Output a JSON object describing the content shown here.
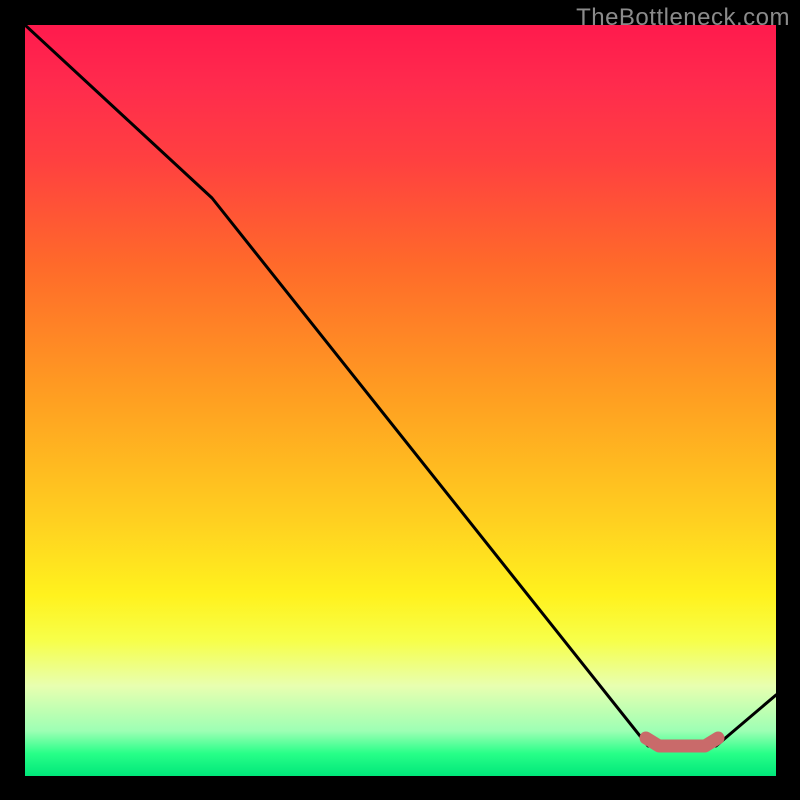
{
  "watermark": "TheBottleneck.com",
  "chart_data": {
    "type": "line",
    "title": "",
    "xlabel": "",
    "ylabel": "",
    "xlim": [
      0,
      1
    ],
    "ylim": [
      0,
      1
    ],
    "series": [
      {
        "name": "bottleneck-curve",
        "x": [
          0.0,
          0.25,
          0.83,
          0.92,
          1.0
        ],
        "y": [
          1.0,
          0.77,
          0.04,
          0.04,
          0.11
        ],
        "color": "#000000"
      },
      {
        "name": "optimal-range",
        "x": [
          0.83,
          0.845,
          0.905,
          0.92
        ],
        "y": [
          0.05,
          0.04,
          0.04,
          0.05
        ],
        "color": "#c96a6a"
      }
    ],
    "gradient_stops": [
      {
        "pos": 0.0,
        "color": "#ff1a4d"
      },
      {
        "pos": 0.5,
        "color": "#ffa021"
      },
      {
        "pos": 0.8,
        "color": "#fff21e"
      },
      {
        "pos": 1.0,
        "color": "#00e77a"
      }
    ]
  }
}
